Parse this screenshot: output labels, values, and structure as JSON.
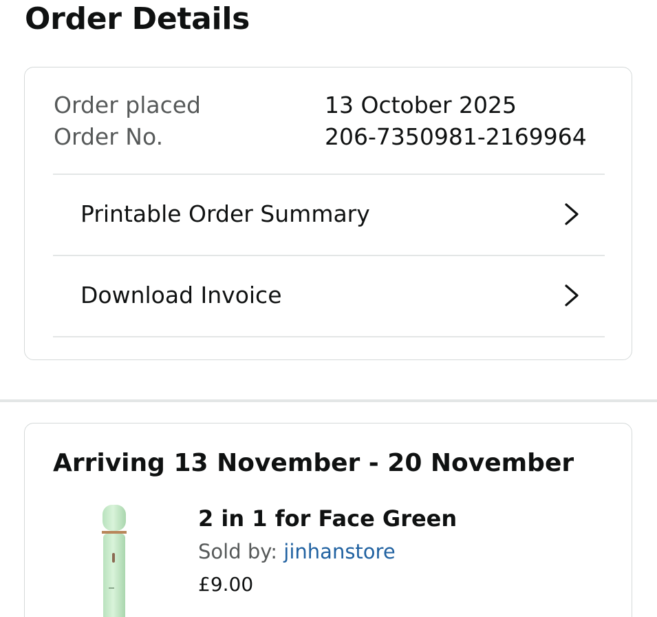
{
  "header": {
    "title": "Order Details"
  },
  "order_summary": {
    "placed_label": "Order placed",
    "placed_value": "13 October 2025",
    "number_label": "Order No.",
    "number_value": "206-7350981-2169964",
    "links": [
      {
        "label": "Printable Order Summary",
        "icon": "chevron-right-icon"
      },
      {
        "label": "Download Invoice",
        "icon": "chevron-right-icon"
      }
    ]
  },
  "shipment": {
    "title": "Arriving 13 November - 20 November",
    "items": [
      {
        "name": "2 in 1 for Face Green",
        "sold_by_label": "Sold by:",
        "seller": "jinhanstore",
        "price": "£9.00",
        "image_color": "#cdeccf"
      }
    ]
  },
  "colors": {
    "link": "#2162a1",
    "muted_text": "#565959",
    "border": "#d5d9d9",
    "divider": "#e3e6e6"
  }
}
